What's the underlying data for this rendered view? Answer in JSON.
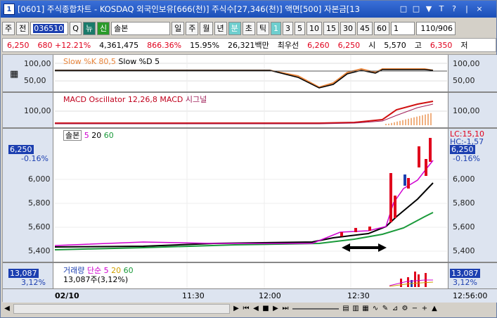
{
  "window": {
    "app_icon": "1",
    "title": "[0601] 주식종합차트 - KOSDAQ 외국인보유[666(천)] 주식수[27,346(천)] 액면[500] 자본금[13",
    "title_buttons": [
      "□",
      "□",
      "▼",
      "T",
      "?",
      "|",
      "×"
    ]
  },
  "toolbar": {
    "type_select": "주",
    "scope_select": "전",
    "code": "036510",
    "code_search_icon": "Q",
    "new_btn": "뉴",
    "sin_btn": "신",
    "stock_name": "솔본",
    "periods": [
      "일",
      "주",
      "월",
      "년",
      "분",
      "초",
      "틱"
    ],
    "period_selected": "분",
    "minutes": [
      "1",
      "3",
      "5",
      "10",
      "15",
      "30",
      "45",
      "60"
    ],
    "minute_selected": "1",
    "multiplier": "1",
    "page_counter": "110/906"
  },
  "quote": {
    "price": "6,250",
    "change": "680 +12.21%",
    "volume": "4,361,475",
    "vol_ratio": "866.36%",
    "turnover": "15.95%",
    "amount": "26,321백만",
    "prefer_label": "최우선",
    "bid": "6,260",
    "ask": "6,250",
    "open_label": "시",
    "open": "5,570",
    "high_label": "고",
    "high": "6,350",
    "low_label": "저"
  },
  "panes": {
    "slow": {
      "label_k": "Slow %K 80,5",
      "label_d": "Slow %D 5",
      "ticks": [
        "100,00",
        "50,00"
      ]
    },
    "macd": {
      "label_osc": "MACD Oscillator 12,26,8",
      "label_macd": "MACD",
      "label_sig": "시그널",
      "ticks": [
        "100,00"
      ]
    },
    "price": {
      "stock_label": "솔본",
      "ma1": "5",
      "ma2": "20",
      "ma3": "60",
      "ticks": [
        "6,000",
        "5,800",
        "5,600",
        "5,400"
      ],
      "current_tag": "6,250",
      "current_pct": "-0.16%",
      "lc": "LC:15,10",
      "hc": "HC:-1,57"
    },
    "volume": {
      "label": "거래량",
      "type": "단순",
      "ma1": "5",
      "ma2": "20",
      "ma3": "60",
      "value_line": "13,087주(3,12%)",
      "tag": "13,087",
      "pct": "3,12%"
    }
  },
  "xaxis": {
    "date": "02/10",
    "times": [
      "11:30",
      "12:00",
      "12:30"
    ],
    "right_time": "12:56:00"
  },
  "colors": {
    "accent": "#1c3fb0",
    "up": "#e0001c",
    "ma5": "#d000d0",
    "ma20": "#000000",
    "ma60": "#1a9a3a"
  }
}
